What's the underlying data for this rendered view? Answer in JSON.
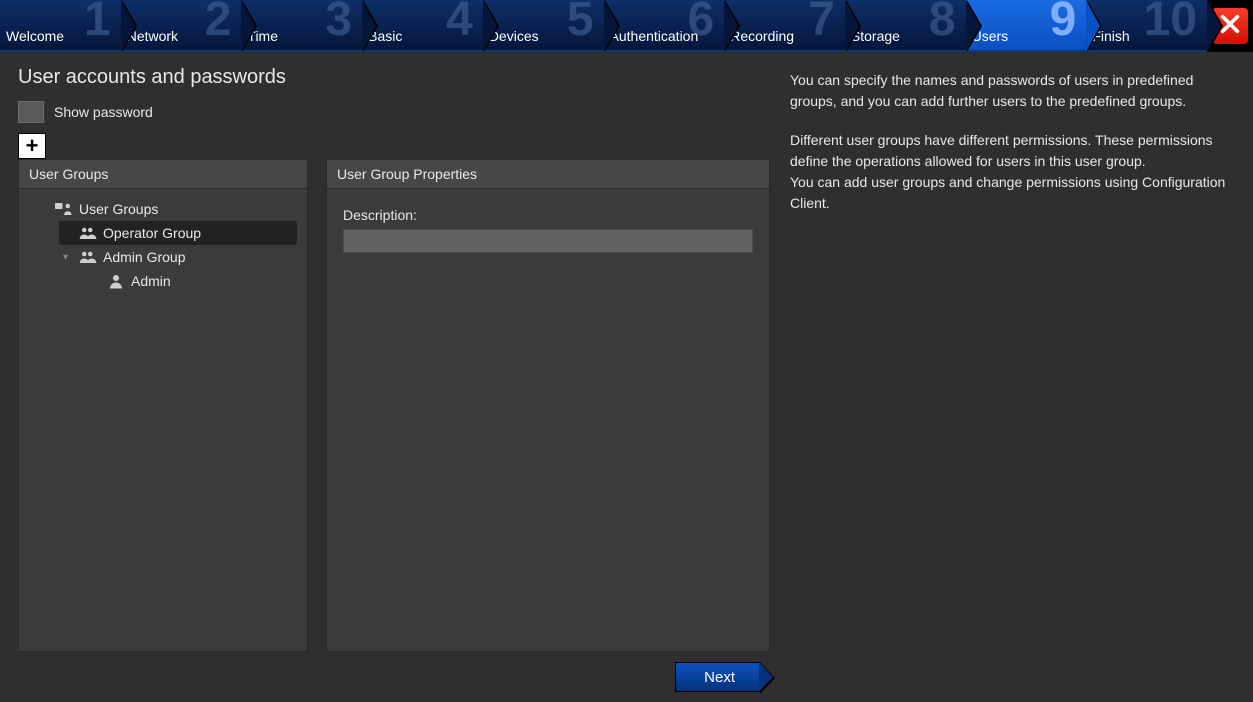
{
  "steps": [
    {
      "num": "1",
      "label": "Welcome"
    },
    {
      "num": "2",
      "label": "Network"
    },
    {
      "num": "3",
      "label": "Time"
    },
    {
      "num": "4",
      "label": "Basic"
    },
    {
      "num": "5",
      "label": "Devices"
    },
    {
      "num": "6",
      "label": "Authentication"
    },
    {
      "num": "7",
      "label": "Recording"
    },
    {
      "num": "8",
      "label": "Storage"
    },
    {
      "num": "9",
      "label": "Users"
    },
    {
      "num": "10",
      "label": "Finish"
    }
  ],
  "active_step_index": 8,
  "page_title": "User accounts and passwords",
  "show_password_label": "Show password",
  "panel_groups_title": "User Groups",
  "panel_props_title": "User Group Properties",
  "prop_description_label": "Description:",
  "prop_description_value": "",
  "tree": {
    "root_label": "User Groups",
    "operator_label": "Operator Group",
    "admin_group_label": "Admin Group",
    "admin_user_label": "Admin"
  },
  "next_label": "Next",
  "help": {
    "p1": "You can specify the names and passwords of users in predefined groups, and you can add further users to the predefined groups.",
    "p2": "Different user groups have different permissions. These permissions define the operations allowed for users in this user group.\nYou can add user groups and change permissions using Configuration Client."
  }
}
